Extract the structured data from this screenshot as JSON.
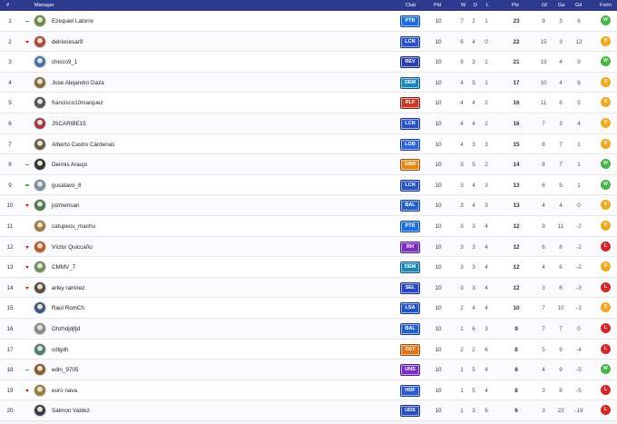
{
  "headers": {
    "pos": "#",
    "manager": "Manager",
    "club": "Club",
    "pld": "Pld",
    "w": "W",
    "d": "D",
    "l": "L",
    "pts": "Pts",
    "gf": "Gf",
    "ga": "Ga",
    "gd": "Gd",
    "form": "Form"
  },
  "colors": {
    "header_bg": "#2c3b8d",
    "win": "#47b548",
    "draw": "#f0a820",
    "loss": "#d52828"
  },
  "rows": [
    {
      "pos": "1",
      "trend": "up",
      "manager": "Ezequiel Latorre",
      "club": "PTR",
      "club_color": "#1c6fe0",
      "pld": "10",
      "w": "7",
      "d": "2",
      "l": "1",
      "pts": "23",
      "gf": "9",
      "ga": "3",
      "gd": "6",
      "form": "W"
    },
    {
      "pos": "2",
      "trend": "down",
      "manager": "delriocesar9",
      "club": "LCN",
      "club_color": "#2a52c9",
      "pld": "10",
      "w": "6",
      "d": "4",
      "l": "0",
      "pts": "22",
      "gf": "15",
      "ga": "3",
      "gd": "12",
      "form": "D"
    },
    {
      "pos": "3",
      "trend": "none",
      "manager": "chisco9_1",
      "club": "REV",
      "club_color": "#2c3fb2",
      "pld": "10",
      "w": "6",
      "d": "3",
      "l": "1",
      "pts": "21",
      "gf": "13",
      "ga": "4",
      "gd": "9",
      "form": "W"
    },
    {
      "pos": "4",
      "trend": "none",
      "manager": "Jose Alejandro Daza",
      "club": "DEM",
      "club_color": "#1a87b8",
      "pld": "10",
      "w": "4",
      "d": "5",
      "l": "1",
      "pts": "17",
      "gf": "10",
      "ga": "4",
      "gd": "6",
      "form": "D"
    },
    {
      "pos": "5",
      "trend": "none",
      "manager": "francisco10marquez",
      "club": "RLF",
      "club_color": "#c43a26",
      "pld": "10",
      "w": "4",
      "d": "4",
      "l": "2",
      "pts": "16",
      "gf": "11",
      "ga": "6",
      "gd": "5",
      "form": "D"
    },
    {
      "pos": "6",
      "trend": "none",
      "manager": "JSCARIBE15",
      "club": "LCN",
      "club_color": "#2a52c9",
      "pld": "10",
      "w": "4",
      "d": "4",
      "l": "2",
      "pts": "16",
      "gf": "7",
      "ga": "3",
      "gd": "4",
      "form": "D"
    },
    {
      "pos": "7",
      "trend": "none",
      "manager": "Alberto Castro Cárdenas",
      "club": "LOB",
      "club_color": "#2c64d4",
      "pld": "10",
      "w": "4",
      "d": "3",
      "l": "3",
      "pts": "15",
      "gf": "8",
      "ga": "7",
      "gd": "1",
      "form": "D"
    },
    {
      "pos": "8",
      "trend": "up",
      "manager": "Dennis Araujo",
      "club": "GBR",
      "club_color": "#e38a17",
      "pld": "10",
      "w": "3",
      "d": "5",
      "l": "2",
      "pts": "14",
      "gf": "8",
      "ga": "7",
      "gd": "1",
      "form": "W"
    },
    {
      "pos": "9",
      "trend": "up",
      "manager": "gusatavo_8",
      "club": "LCN",
      "club_color": "#2a52c9",
      "pld": "10",
      "w": "3",
      "d": "4",
      "l": "3",
      "pts": "13",
      "gf": "6",
      "ga": "5",
      "gd": "1",
      "form": "W"
    },
    {
      "pos": "10",
      "trend": "down",
      "manager": "jozmensan",
      "club": "BAL",
      "club_color": "#2562c8",
      "pld": "10",
      "w": "3",
      "d": "4",
      "l": "3",
      "pts": "13",
      "gf": "4",
      "ga": "4",
      "gd": "0",
      "form": "D"
    },
    {
      "pos": "11",
      "trend": "none",
      "manager": "catupecu_machu",
      "club": "PTR",
      "club_color": "#1c6fe0",
      "pld": "10",
      "w": "3",
      "d": "3",
      "l": "4",
      "pts": "12",
      "gf": "9",
      "ga": "11",
      "gd": "-2",
      "form": "D"
    },
    {
      "pos": "12",
      "trend": "down",
      "manager": "Víctor Quiccaño",
      "club": "RH",
      "club_color": "#7d2fc0",
      "pld": "10",
      "w": "3",
      "d": "3",
      "l": "4",
      "pts": "12",
      "gf": "6",
      "ga": "8",
      "gd": "-2",
      "form": "L"
    },
    {
      "pos": "13",
      "trend": "down",
      "manager": "CMMV_7",
      "club": "DEM",
      "club_color": "#1a87b8",
      "pld": "10",
      "w": "3",
      "d": "3",
      "l": "4",
      "pts": "12",
      "gf": "4",
      "ga": "6",
      "gd": "-2",
      "form": "D"
    },
    {
      "pos": "14",
      "trend": "down",
      "manager": "arley ramirez",
      "club": "SEL",
      "club_color": "#2749c4",
      "pld": "10",
      "w": "3",
      "d": "3",
      "l": "4",
      "pts": "12",
      "gf": "3",
      "ga": "6",
      "gd": "-3",
      "form": "L"
    },
    {
      "pos": "15",
      "trend": "none",
      "manager": "Raúl RomCh",
      "club": "LSA",
      "club_color": "#2356c2",
      "pld": "10",
      "w": "2",
      "d": "4",
      "l": "4",
      "pts": "10",
      "gf": "7",
      "ga": "10",
      "gd": "-3",
      "form": "D"
    },
    {
      "pos": "16",
      "trend": "none",
      "manager": "Dhzhdjdjfjd",
      "club": "BAL",
      "club_color": "#2562c8",
      "pld": "10",
      "w": "1",
      "d": "6",
      "l": "3",
      "pts": "9",
      "gf": "7",
      "ga": "7",
      "gd": "0",
      "form": "L"
    },
    {
      "pos": "17",
      "trend": "none",
      "manager": "cdlgdh",
      "club": "ZGT",
      "club_color": "#e0761a",
      "pld": "10",
      "w": "2",
      "d": "2",
      "l": "6",
      "pts": "8",
      "gf": "5",
      "ga": "9",
      "gd": "-4",
      "form": "L"
    },
    {
      "pos": "18",
      "trend": "up",
      "manager": "edin_9705",
      "club": "UNS",
      "club_color": "#7a2fc4",
      "pld": "10",
      "w": "1",
      "d": "5",
      "l": "4",
      "pts": "8",
      "gf": "4",
      "ga": "9",
      "gd": "-5",
      "form": "W"
    },
    {
      "pos": "19",
      "trend": "down",
      "manager": "euro nava",
      "club": "HDF",
      "club_color": "#2f5bd0",
      "pld": "10",
      "w": "1",
      "d": "5",
      "l": "4",
      "pts": "8",
      "gf": "3",
      "ga": "8",
      "gd": "-5",
      "form": "L"
    },
    {
      "pos": "20",
      "trend": "none",
      "manager": "Salmon Valdez",
      "club": "UDS",
      "club_color": "#2a4fc0",
      "pld": "10",
      "w": "1",
      "d": "3",
      "l": "6",
      "pts": "6",
      "gf": "3",
      "ga": "22",
      "gd": "-19",
      "form": "L"
    }
  ]
}
